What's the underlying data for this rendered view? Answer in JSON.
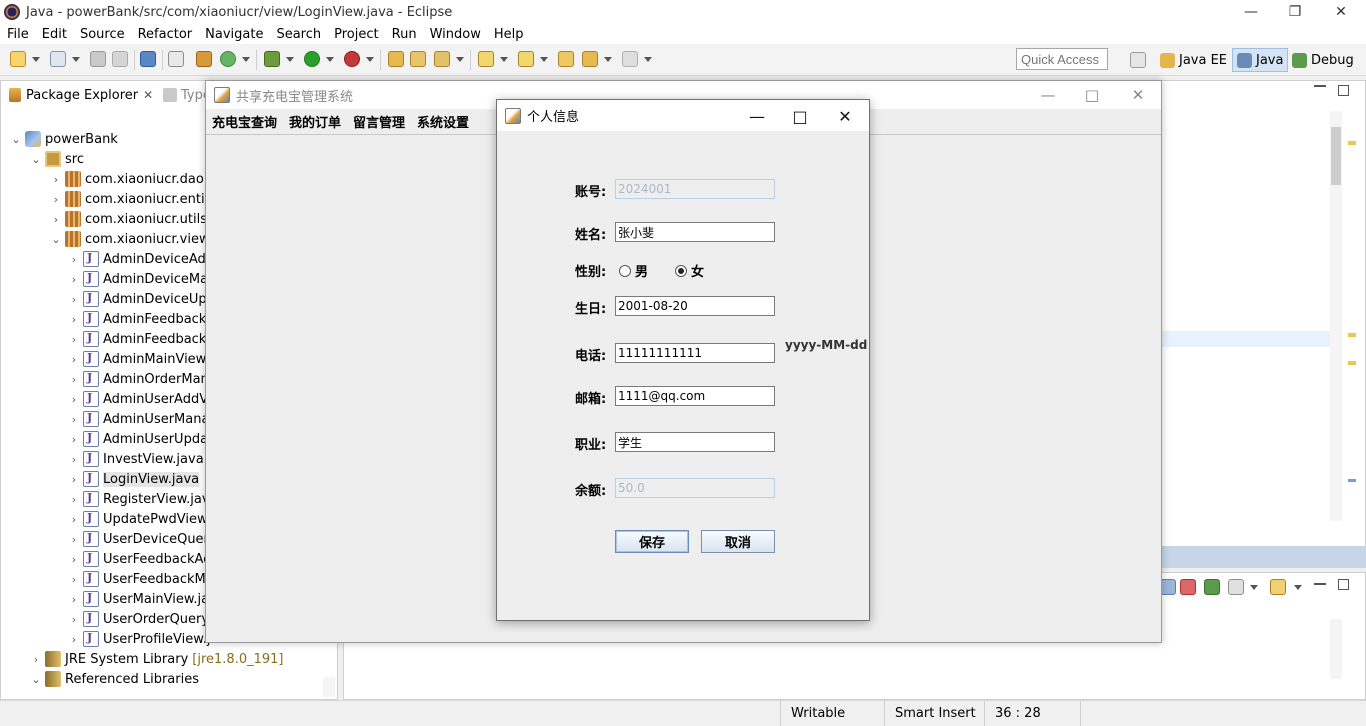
{
  "eclipse": {
    "title": "Java - powerBank/src/com/xiaoniucr/view/LoginView.java - Eclipse",
    "menu": [
      "File",
      "Edit",
      "Source",
      "Refactor",
      "Navigate",
      "Search",
      "Project",
      "Run",
      "Window",
      "Help"
    ],
    "quick_access": "Quick Access",
    "perspectives": [
      "Java EE",
      "Java",
      "Debug"
    ]
  },
  "package_explorer": {
    "tab_label": "Package Explorer",
    "type_tab_label": "Type",
    "project": "powerBank",
    "src": "src",
    "packages": [
      "com.xiaoniucr.dao",
      "com.xiaoniucr.entity",
      "com.xiaoniucr.utils",
      "com.xiaoniucr.view"
    ],
    "files": [
      "AdminDeviceAdd",
      "AdminDeviceMan",
      "AdminDeviceUpd",
      "AdminFeedbackM",
      "AdminFeedbackR",
      "AdminMainView.j",
      "AdminOrderMana",
      "AdminUserAddVi",
      "AdminUserManag",
      "AdminUserUpdat",
      "InvestView.java",
      "LoginView.java",
      "RegisterView.java",
      "UpdatePwdView.j",
      "UserDeviceQuery",
      "UserFeedbackAd",
      "UserFeedbackMa",
      "UserMainView.jav",
      "UserOrderQueryV",
      "UserProfileView.ja"
    ],
    "selected_file": "LoginView.java",
    "jre_label": "JRE System Library",
    "jre_suffix": "[jre1.8.0_191]",
    "referenced_libraries": "Referenced Libraries"
  },
  "status_bar": {
    "writable": "Writable",
    "insert_mode": "Smart Insert",
    "position": "36 : 28"
  },
  "main_window": {
    "title": "共享充电宝管理系统",
    "menus": [
      "充电宝查询",
      "我的订单",
      "留言管理",
      "系统设置"
    ]
  },
  "dialog": {
    "title": "个人信息",
    "account_label": "账号:",
    "account_value": "2024001",
    "name_label": "姓名:",
    "name_value": "张小斐",
    "gender_label": "性别:",
    "gender_male": "男",
    "gender_female": "女",
    "gender_selected": "女",
    "birthday_label": "生日:",
    "birthday_value": "2001-08-20",
    "date_format_hint": "yyyy-MM-dd",
    "phone_label": "电话:",
    "phone_value": "11111111111",
    "email_label": "邮箱:",
    "email_value": "1111@qq.com",
    "job_label": "职业:",
    "job_value": "学生",
    "balance_label": "余额:",
    "balance_value": "50.0",
    "save_button": "保存",
    "cancel_button": "取消"
  },
  "icons": {
    "minimize": "minimize-icon",
    "maximize": "maximize-icon",
    "close": "close-icon"
  }
}
